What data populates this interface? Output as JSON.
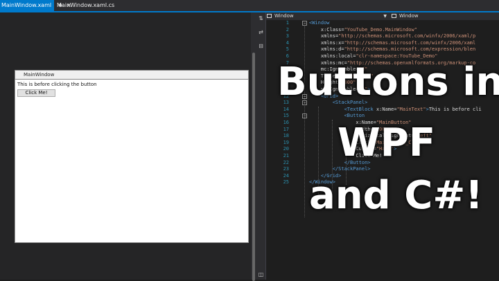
{
  "tabs": {
    "active_label": "MainWindow.xaml",
    "pin_glyph": "⊕",
    "close_glyph": "×",
    "inactive_label": "MainWindow.xaml.cs"
  },
  "preview": {
    "title": "MainWindow",
    "textblock": "This is before clicking the button",
    "button_label": "Click Me!"
  },
  "navbar": {
    "left_label": "Window",
    "right_label": "Window"
  },
  "code_lines": [
    {
      "n": "1",
      "t": "<Window"
    },
    {
      "n": "2",
      "t": "    x:Class=\"YouTube_Demo.MainWindow\""
    },
    {
      "n": "3",
      "t": "    xmlns=\"http://schemas.microsoft.com/winfx/2006/xaml/p"
    },
    {
      "n": "4",
      "t": "    xmlns:x=\"http://schemas.microsoft.com/winfx/2006/xaml"
    },
    {
      "n": "5",
      "t": "    xmlns:d=\"http://schemas.microsoft.com/expression/blen"
    },
    {
      "n": "6",
      "t": "    xmlns:local=\"clr-namespace:YouTube_Demo\""
    },
    {
      "n": "7",
      "t": "    xmlns:mc=\"http://schemas.openxmlformats.org/markup-co"
    },
    {
      "n": "8",
      "t": "    mc:Ignorable=\"d\""
    },
    {
      "n": "9",
      "t": "    Title=\"MainWindow\""
    },
    {
      "n": "10",
      "t": "    Height=\"800\""
    },
    {
      "n": "11",
      "t": "    mc:Ignorable=\"d\">"
    },
    {
      "n": "12",
      "t": "    <Grid>"
    },
    {
      "n": "13",
      "t": "        <StackPanel>"
    },
    {
      "n": "14",
      "t": "            <TextBlock x:Name=\"MainText\">This is before cli"
    },
    {
      "n": "15",
      "t": "            <Button"
    },
    {
      "n": "16",
      "t": "                x:Name=\"MainButton\""
    },
    {
      "n": "17",
      "t": "                Width=\"100px\""
    },
    {
      "n": "18",
      "t": "                HorizontalAlignment=\"Left\""
    },
    {
      "n": "19",
      "t": "                Click=\"MainButton_Click\""
    },
    {
      "n": "20",
      "t": "                Cursor=\"Hand\">"
    },
    {
      "n": "21",
      "t": "                Click Me!"
    },
    {
      "n": "22",
      "t": "            </Button>"
    },
    {
      "n": "23",
      "t": "        </StackPanel>"
    },
    {
      "n": "24",
      "t": "    </Grid>"
    },
    {
      "n": "25",
      "t": "</Window>"
    }
  ],
  "overlay": {
    "line1": "Buttons in",
    "line2": "WPF",
    "line3": "and C#!"
  },
  "colors": {
    "accent": "#007acc",
    "element": "#569cd6",
    "attribute": "#92caf4",
    "string": "#ce9178",
    "line_number": "#2b91af"
  }
}
